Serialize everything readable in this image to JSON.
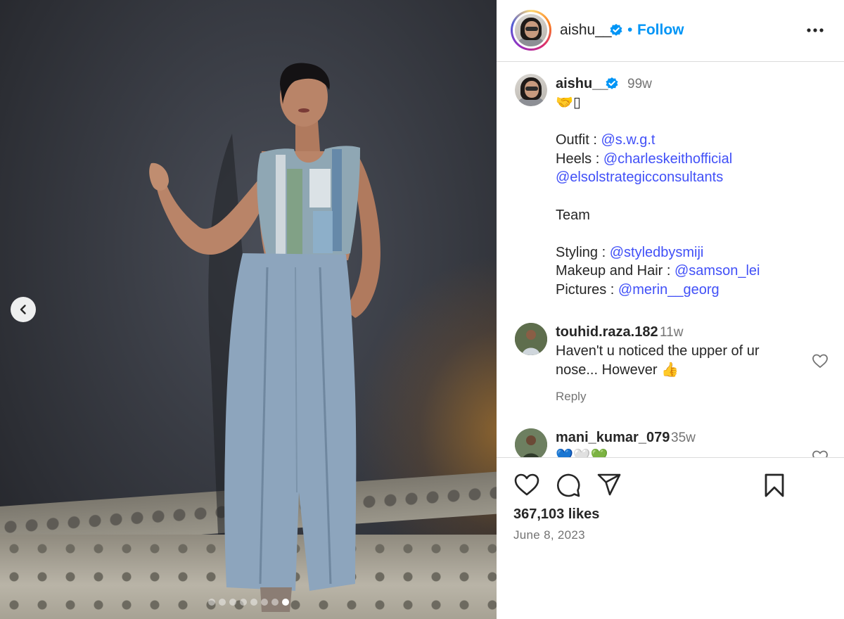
{
  "post": {
    "author": "aishu__",
    "follow_label": "Follow",
    "separator": "•",
    "verified_icon": "verified-badge-icon",
    "more_icon": "more-options-icon",
    "carousel": {
      "total_slides": 8,
      "active_slide": 8
    },
    "caption": {
      "username": "aishu__",
      "time": "99w",
      "emoji_line": "🤝▯",
      "outfit_label": "Outfit : ",
      "outfit_mention": "@s.w.g.t",
      "heels_label": "Heels : ",
      "heels_mention": "@charleskeithofficial",
      "extra_mention": "@elsolstrategicconsultants",
      "team_label": "Team",
      "styling_label": "Styling : ",
      "styling_mention": "@styledbysmiji",
      "makeup_label": "Makeup and Hair : ",
      "makeup_mention": "@samson_lei",
      "pictures_label": "Pictures : ",
      "pictures_mention": "@merin__georg"
    },
    "comments": [
      {
        "username": "touhid.raza.182",
        "time": "11w",
        "text_line1": "Haven't u noticed the upper of ur",
        "text_line2": "nose... However 👍",
        "reply_label": "Reply"
      },
      {
        "username": "mani_kumar_079",
        "time": "35w",
        "text": "💙🤍💚"
      }
    ],
    "likes_text": "367,103 likes",
    "date": "June 8, 2023",
    "colors": {
      "link": "#0095f6",
      "mention": "#4150f7",
      "muted": "#737373",
      "text": "#262626",
      "divider": "#dbdbdb"
    }
  }
}
